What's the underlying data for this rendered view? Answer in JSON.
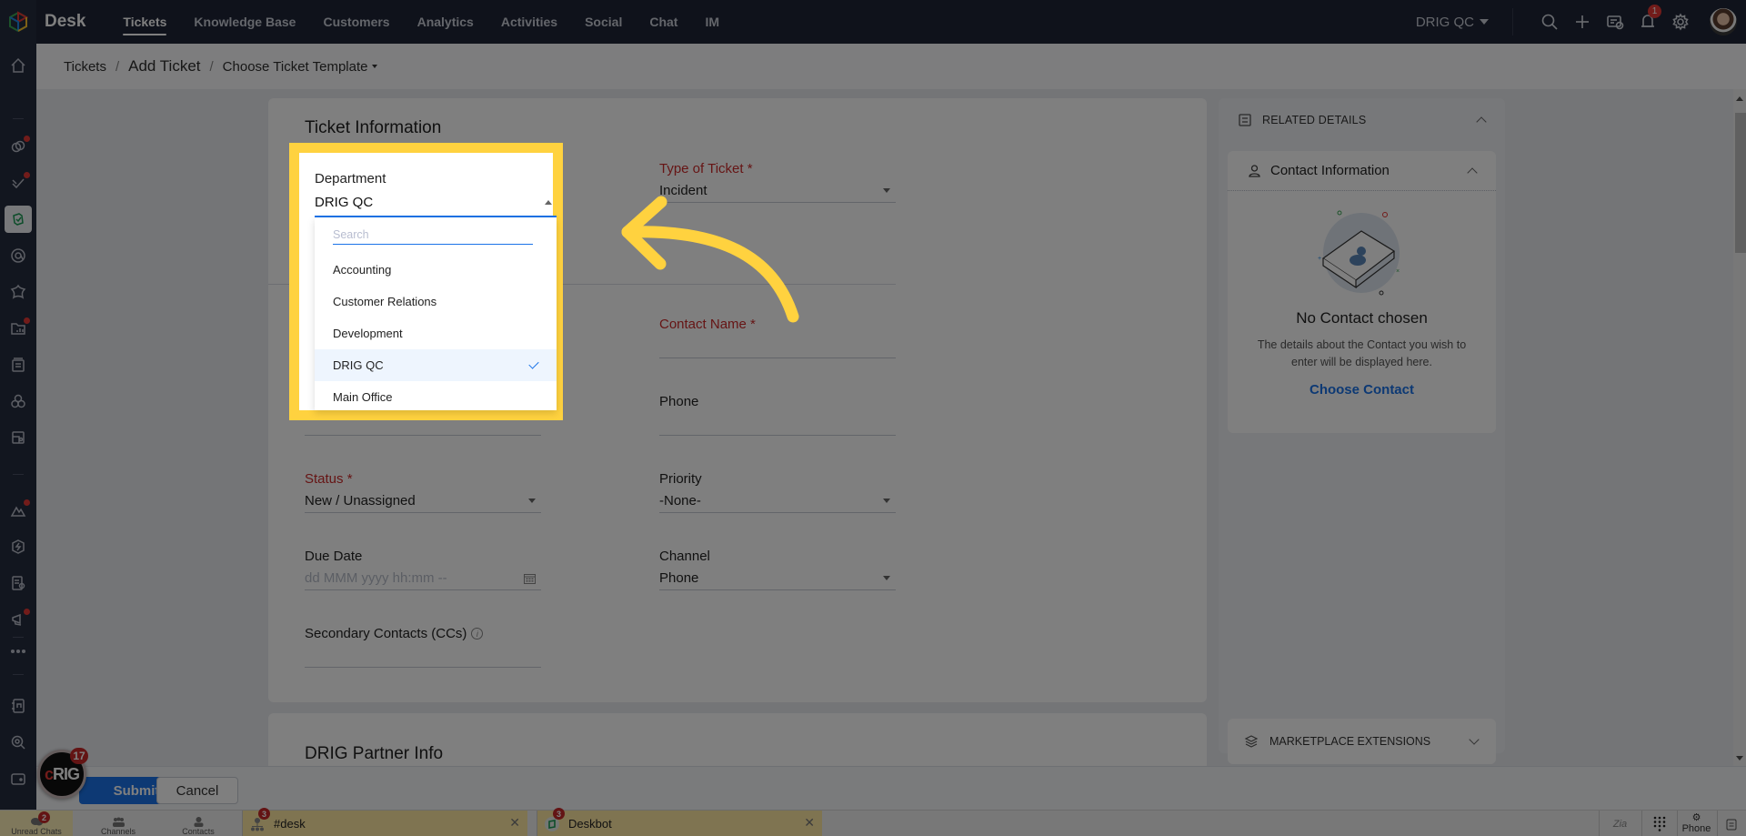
{
  "topbar": {
    "app_title": "Desk",
    "nav": [
      "Tickets",
      "Knowledge Base",
      "Customers",
      "Analytics",
      "Activities",
      "Social",
      "Chat",
      "IM"
    ],
    "active_nav": "Tickets",
    "department_switch": "DRIG QC",
    "notification_count": "1",
    "icons": [
      "search-icon",
      "plus-icon",
      "ticket-info-icon",
      "bell-icon",
      "gear-icon",
      "avatar"
    ]
  },
  "sidebar": {
    "items": [
      "home",
      "collaboration",
      "approvals",
      "tickets",
      "mentions",
      "integrations",
      "reports",
      "articles",
      "modules",
      "layouts",
      "community",
      "automation",
      "knowledge",
      "campaigns",
      "more",
      "notebook",
      "search-analysis",
      "wallet",
      "tags"
    ],
    "active": "tickets"
  },
  "breadcrumb": {
    "root": "Tickets",
    "separator": "/",
    "current": "Add Ticket",
    "template_menu": "Choose Ticket Template"
  },
  "form": {
    "section_title": "Ticket Information",
    "department": {
      "label": "Department",
      "value": "DRIG QC"
    },
    "type_of_ticket": {
      "label": "Type of Ticket *",
      "value": "Incident"
    },
    "contact_name": {
      "label": "Contact Name *",
      "value": ""
    },
    "phone": {
      "label": "Phone",
      "value": ""
    },
    "status": {
      "label": "Status *",
      "value": "New / Unassigned"
    },
    "priority": {
      "label": "Priority",
      "value": "-None-"
    },
    "due_date": {
      "label": "Due Date",
      "placeholder": "dd MMM yyyy hh:mm --"
    },
    "channel": {
      "label": "Channel",
      "value": "Phone"
    },
    "secondary_contacts": {
      "label": "Secondary Contacts (CCs)"
    },
    "section2_title": "DRIG Partner Info"
  },
  "department_dropdown": {
    "search_placeholder": "Search",
    "options": [
      "Accounting",
      "Customer Relations",
      "Development",
      "DRIG QC",
      "Main Office"
    ],
    "selected": "DRIG QC"
  },
  "right_panel": {
    "related_details": "RELATED DETAILS",
    "contact_info_title": "Contact Information",
    "empty_title": "No Contact chosen",
    "empty_desc": "The details about the Contact you wish to enter will be displayed here.",
    "choose_contact": "Choose Contact",
    "marketplace": "MARKETPLACE EXTENSIONS"
  },
  "footer": {
    "submit": "Submit",
    "cancel": "Cancel",
    "bubble_text": "RIG",
    "bubble_badge": "17"
  },
  "bottombar": {
    "tabs": [
      {
        "label": "Unread Chats",
        "badge": "2"
      },
      {
        "label": "Channels"
      },
      {
        "label": "Contacts"
      }
    ],
    "chats": [
      {
        "name": "#desk",
        "badge": "3"
      },
      {
        "name": "Deskbot",
        "badge": "3"
      }
    ],
    "right_items": [
      "zia",
      "dialpad",
      "Phone",
      "notes"
    ],
    "phone_label": "Phone"
  },
  "annotation": {
    "highlight_color": "#ffd23f"
  }
}
